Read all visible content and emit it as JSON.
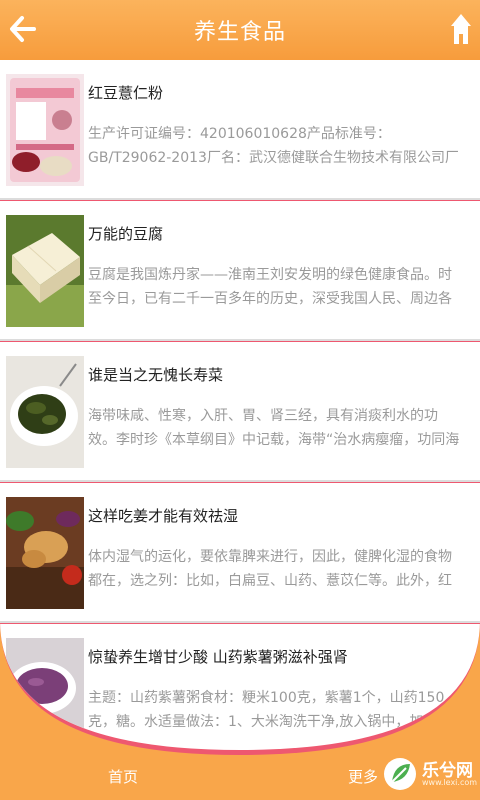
{
  "header": {
    "title": "养生食品",
    "back_icon": "arrow-left-icon",
    "home_icon": "home-icon"
  },
  "items": [
    {
      "title": "红豆薏仁粉",
      "desc": "生产许可证编号：420106010628产品标准号：GB/T29062-2013厂名：武汉德健联合生物技术有限公司厂址：湖北省武汉市东西",
      "thumb": "packaged-powder-image"
    },
    {
      "title": "万能的豆腐",
      "desc": "豆腐是我国炼丹家——淮南王刘安发明的绿色健康食品。时至今日，已有二千一百多年的历史，深受我国人民、周边各国、及世",
      "thumb": "tofu-image"
    },
    {
      "title": "谁是当之无愧长寿菜",
      "desc": "海带味咸、性寒，入肝、胃、肾三经，具有消痰利水的功效。李时珍《本草纲目》中记载，海带“治水病瘿瘤，功同海藻。”现",
      "thumb": "seaweed-image"
    },
    {
      "title": "这样吃姜才能有效祛湿",
      "desc": "体内湿气的运化，要依靠脾来进行，因此，健脾化湿的食物都在，选之列：比如，白扁豆、山药、薏苡仁等。此外，红豆可以煮",
      "thumb": "ginger-vegetables-image"
    },
    {
      "title": "惊蛰养生增甘少酸 山药紫薯粥滋补强肾",
      "desc": "主题：山药紫薯粥食材：粳米100克，紫薯1个，山药150克，糖。水适量做法：1、大米淘洗干净,放入锅中，加入足量",
      "thumb": "purple-porridge-image"
    }
  ],
  "tabbar": {
    "home_label": "首页",
    "more_label": "更多"
  },
  "watermark": {
    "name": "乐兮网",
    "sub": "www.lexi.com"
  },
  "colors": {
    "orange": "#f9a64a",
    "pink_border": "#ee5870",
    "text_gray": "#9a9a9a"
  }
}
